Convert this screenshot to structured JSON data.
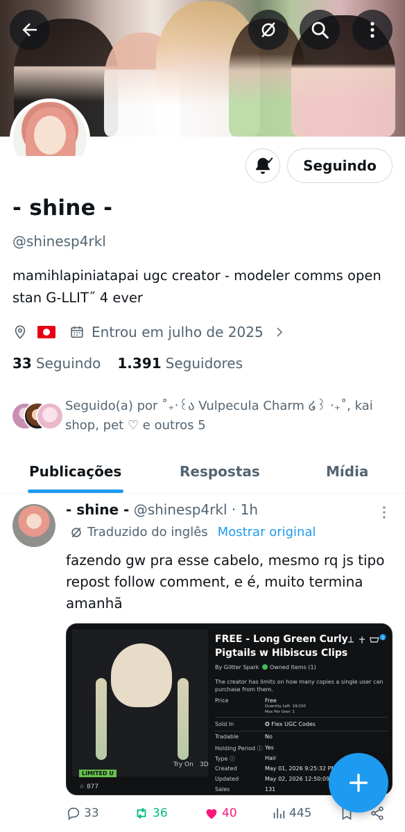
{
  "header": {
    "back_icon": "arrow-left-icon",
    "translate_icon": "translate-off-icon",
    "search_icon": "search-icon",
    "more_icon": "more-vertical-icon"
  },
  "profile": {
    "name": "- shine -",
    "handle": "@shinesp4rkl",
    "bio": "mamihlapiniatapai ugc creator - modeler comms open stan G-LLIT˝ 4 ever",
    "joined": "Entrou em julho de 2025",
    "following_count": "33",
    "following_label": "Seguindo",
    "followers_count": "1.391",
    "followers_label": "Seguidores",
    "follow_button": "Seguindo",
    "followed_by": "Seguido(a) por ˚₊‧꒰ა Vulpecula Charm ໒꒱ ‧₊˚, kai shop, pet ♡ e outros 5"
  },
  "tabs": [
    {
      "label": "Publicações",
      "active": true
    },
    {
      "label": "Respostas",
      "active": false
    },
    {
      "label": "Mídia",
      "active": false
    }
  ],
  "post": {
    "author": "- shine -",
    "handle": "@shinesp4rkl",
    "time": "· 1h",
    "translated_label": "Traduzido do inglês",
    "show_original": "Mostrar original",
    "text": "fazendo gw pra esse cabelo, mesmo rq js tipo repost follow comment, e é, muito termina amanhã",
    "replies": "33",
    "reposts": "36",
    "likes": "40",
    "views": "445"
  },
  "media": {
    "title": "FREE - Long Green Curly Pigtails w Hibiscus Clips",
    "by": "By Glitter Spark",
    "owned": "Owned Items (1)",
    "limit_note": "The creator has limits on how many copies a single user can purchase from them.",
    "limited_badge": "LIMITED U",
    "try_on": "Try On",
    "three_d": "3D",
    "favorites": "877",
    "cart_badge": "1",
    "rows": [
      {
        "label": "Price",
        "value": "Free"
      },
      {
        "label": "Sold In",
        "value": "Flex UGC Codes"
      },
      {
        "label": "Tradable",
        "value": "No"
      },
      {
        "label": "Holding Period ⓘ",
        "value": "Yes"
      },
      {
        "label": "Type ⓘ",
        "value": "Hair"
      },
      {
        "label": "Created",
        "value": "May 01, 2026 9:25:32 PM"
      },
      {
        "label": "Updated",
        "value": "May 02, 2026 12:50:09 PM"
      },
      {
        "label": "Sales",
        "value": "131"
      }
    ],
    "quantity_left": "Quantity Left: 19/150",
    "max_per_user": "Max Per User: 1"
  },
  "colors": {
    "accent": "#1d9bf0",
    "repost": "#00ba7c",
    "like": "#f91880",
    "text": "#0f1419",
    "muted": "#536471"
  }
}
